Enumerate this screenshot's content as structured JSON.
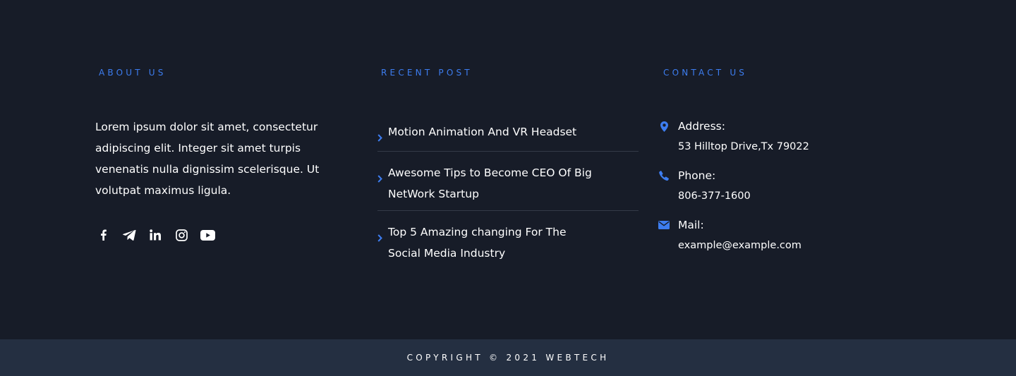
{
  "about": {
    "heading": "ABOUT US",
    "text": "Lorem ipsum dolor sit amet, consectetur adipiscing elit. Integer sit amet turpis venenatis nulla dignissim scelerisque. Ut volutpat maximus ligula.",
    "social": [
      {
        "icon": "facebook-icon"
      },
      {
        "icon": "telegram-icon"
      },
      {
        "icon": "linkedin-icon"
      },
      {
        "icon": "instagram-icon"
      },
      {
        "icon": "youtube-icon"
      }
    ]
  },
  "recent_post": {
    "heading": "RECENT POST",
    "posts": [
      {
        "title": "Motion Animation And VR Headset"
      },
      {
        "title": "Awesome Tips to Become CEO Of Big NetWork Startup"
      },
      {
        "title": "Top 5 Amazing changing For The Social Media Industry"
      }
    ]
  },
  "contact": {
    "heading": "CONTACT US",
    "address": {
      "label": "Address:",
      "value": "53  Hilltop Drive,Tx 79022",
      "icon": "map-pin-icon"
    },
    "phone": {
      "label": "Phone:",
      "value": "806-377-1600",
      "icon": "phone-icon"
    },
    "mail": {
      "label": "Mail:",
      "value": "example@example.com",
      "icon": "envelope-icon"
    }
  },
  "copyright": {
    "text": "COPYRIGHT © 2021 WEBTECH"
  },
  "colors": {
    "background": "#171c28",
    "copyright_bar": "#242f41",
    "accent": "#3d7df0",
    "divider": "#343a48",
    "text": "#ffffff"
  }
}
